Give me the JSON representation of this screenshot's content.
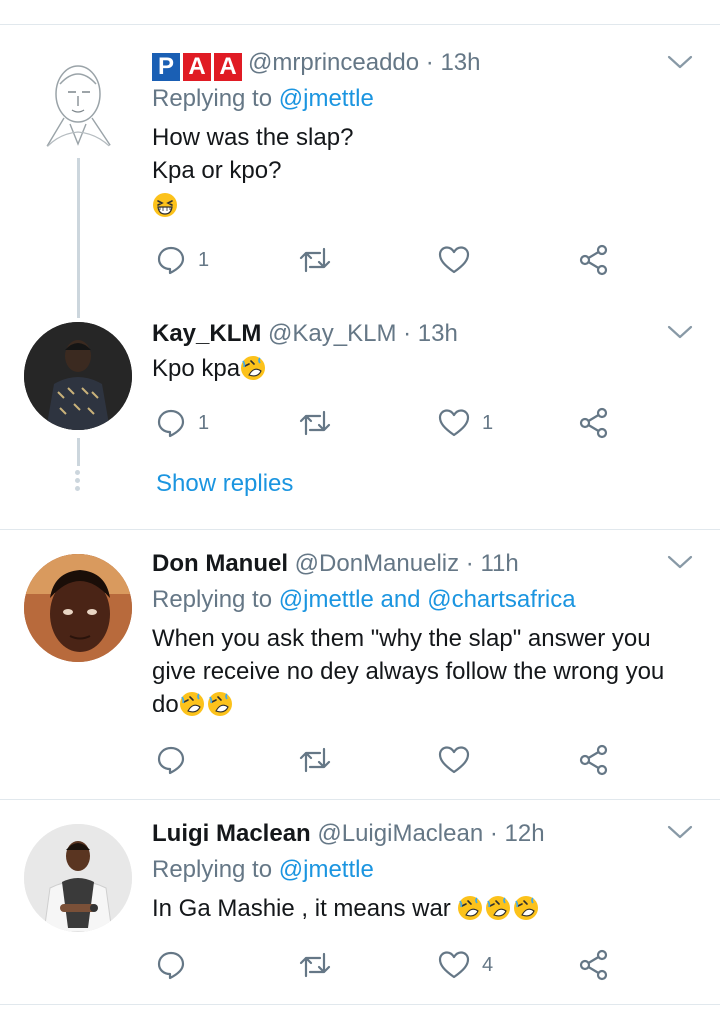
{
  "tweets": [
    {
      "logo_letters": [
        "P",
        "A",
        "A"
      ],
      "logo_colors": [
        "#1a5fb4",
        "#e01b24",
        "#e01b24"
      ],
      "name": "",
      "handle": "@mrprinceaddo",
      "time": "· 13h",
      "replying_label": "Replying to",
      "replying_to": "@jmettle",
      "lines": [
        "How was the slap?",
        "Kpa or kpo?"
      ],
      "emoji": "grinning-squinting",
      "reply_count": "1",
      "retweet_count": "",
      "like_count": ""
    },
    {
      "name": "Kay_KLM",
      "handle": "@Kay_KLM",
      "time": "· 13h",
      "text": "Kpo kpa",
      "emoji": "rofl",
      "reply_count": "1",
      "retweet_count": "",
      "like_count": "1",
      "show_replies": "Show replies"
    },
    {
      "name": "Don Manuel",
      "handle": "@DonManueliz",
      "time": "· 11h",
      "replying_label": "Replying to",
      "replying_to_1": "@jmettle",
      "replying_and": "and",
      "replying_to_2": "@chartsafrica",
      "lines": [
        "When you ask them \"why the slap\" answer you",
        "give receive no dey always follow the wrong you",
        "do"
      ],
      "emoji": "rofl",
      "reply_count": "",
      "retweet_count": "",
      "like_count": ""
    },
    {
      "name": "Luigi Maclean",
      "handle": "@LuigiMaclean",
      "time": "· 12h",
      "replying_label": "Replying to",
      "replying_to": "@jmettle",
      "text": "In Ga Mashie , it means war",
      "emoji": "rofl",
      "reply_count": "",
      "retweet_count": "",
      "like_count": "4"
    }
  ],
  "colors": {
    "link": "#1b95e0",
    "muted": "#657786",
    "divider": "#e1e8ed",
    "thread_line": "#ccd6dd",
    "text": "#14171a"
  }
}
